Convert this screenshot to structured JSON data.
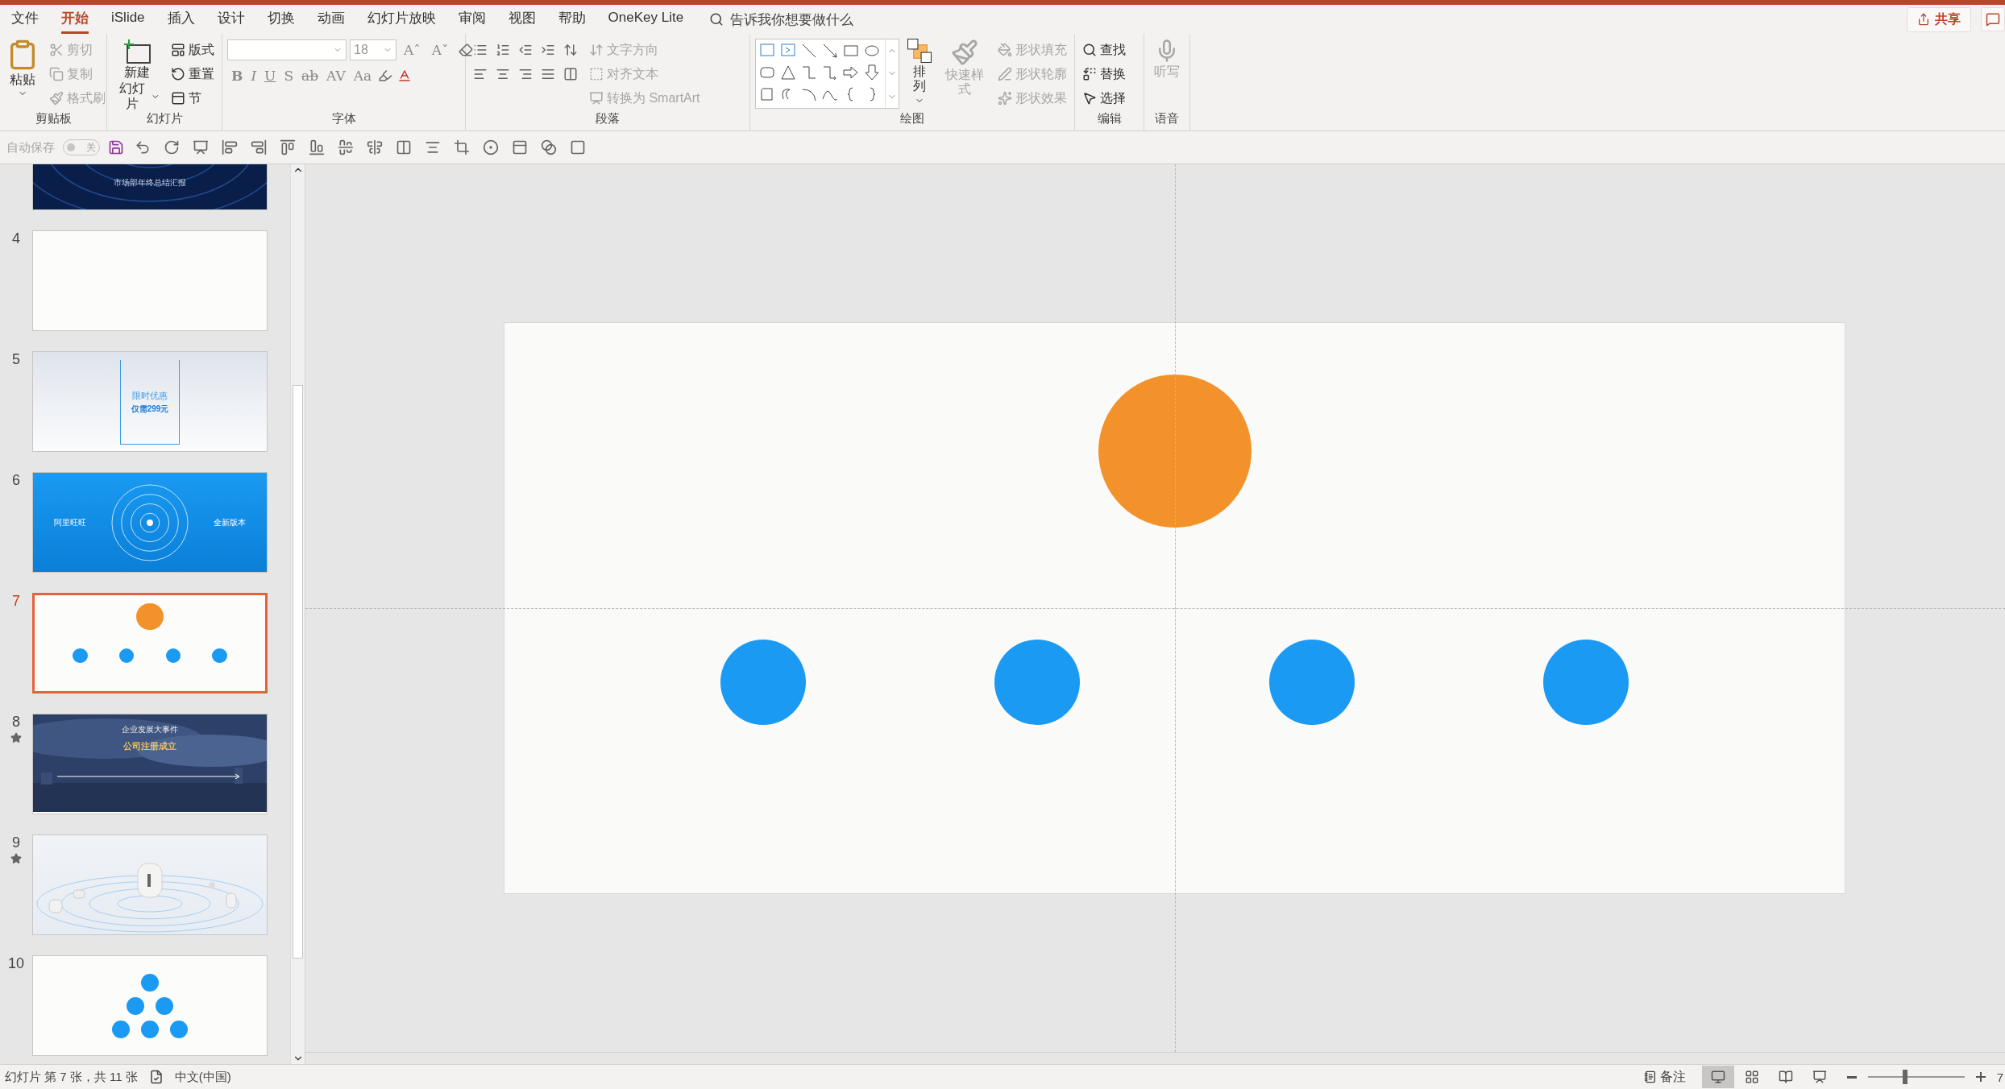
{
  "menu_tabs": [
    {
      "label": "文件",
      "selected": false
    },
    {
      "label": "开始",
      "selected": true
    },
    {
      "label": "iSlide",
      "selected": false
    },
    {
      "label": "插入",
      "selected": false
    },
    {
      "label": "设计",
      "selected": false
    },
    {
      "label": "切换",
      "selected": false
    },
    {
      "label": "动画",
      "selected": false
    },
    {
      "label": "幻灯片放映",
      "selected": false
    },
    {
      "label": "审阅",
      "selected": false
    },
    {
      "label": "视图",
      "selected": false
    },
    {
      "label": "帮助",
      "selected": false
    },
    {
      "label": "OneKey Lite",
      "selected": false
    }
  ],
  "tell_me": {
    "placeholder": "告诉我你想要做什么"
  },
  "share_button": "共享",
  "ribbon": {
    "clipboard": {
      "label": "剪贴板",
      "paste": "粘贴",
      "items": [
        {
          "label": "剪切",
          "disabled": true
        },
        {
          "label": "复制",
          "disabled": true
        },
        {
          "label": "格式刷",
          "disabled": true
        }
      ]
    },
    "slides": {
      "label": "幻灯片",
      "new_slide": [
        "新建",
        "幻灯片"
      ],
      "items": [
        {
          "label": "版式",
          "disabled": false
        },
        {
          "label": "重置",
          "disabled": false
        },
        {
          "label": "节",
          "disabled": false
        }
      ]
    },
    "font": {
      "label": "字体",
      "font_size": "18",
      "size_buttons": [
        "Aˆ",
        "Aˇ"
      ],
      "format_buttons": [
        "B",
        "I",
        "U",
        "S",
        "ab",
        "AV",
        "Aa"
      ]
    },
    "paragraph": {
      "label": "段落",
      "items": [
        {
          "label": "文字方向",
          "disabled": true
        },
        {
          "label": "对齐文本",
          "disabled": true
        },
        {
          "label": "转换为 SmartArt",
          "disabled": true
        }
      ]
    },
    "drawing": {
      "label": "绘图",
      "arrange": "排列",
      "quick_styles": {
        "label": "快速样式",
        "disabled": true
      },
      "items": [
        {
          "label": "形状填充",
          "disabled": true
        },
        {
          "label": "形状轮廓",
          "disabled": true
        },
        {
          "label": "形状效果",
          "disabled": true
        }
      ]
    },
    "editing": {
      "label": "编辑",
      "items": [
        {
          "label": "查找",
          "disabled": false
        },
        {
          "label": "替换",
          "disabled": false
        },
        {
          "label": "选择",
          "disabled": false
        }
      ]
    },
    "voice": {
      "label": "语音",
      "dictate": {
        "label": "听写",
        "disabled": true
      }
    }
  },
  "quick_access": {
    "autosave": {
      "label": "自动保存",
      "toggle": "关",
      "on": false
    }
  },
  "thumbnails": [
    {
      "kind": "dark_title",
      "selected": false,
      "animated": false,
      "texts": [
        "市场部年终总结汇报"
      ]
    },
    {
      "number": "4",
      "kind": "blank",
      "selected": false,
      "animated": false
    },
    {
      "number": "5",
      "kind": "banner",
      "selected": false,
      "animated": false,
      "texts": [
        "限时优惠",
        "仅需299元"
      ]
    },
    {
      "number": "6",
      "kind": "blue_title",
      "selected": false,
      "animated": false,
      "texts": [
        "阿里旺旺",
        "全新版本"
      ]
    },
    {
      "number": "7",
      "kind": "circles_row",
      "selected": true,
      "animated": false
    },
    {
      "number": "8",
      "kind": "photo_timeline",
      "selected": false,
      "animated": true,
      "texts": [
        "企业发展大事件",
        "公司注册成立"
      ]
    },
    {
      "number": "9",
      "kind": "product",
      "selected": false,
      "animated": true
    },
    {
      "number": "10",
      "kind": "circles_pyramid",
      "selected": false,
      "animated": false
    }
  ],
  "slide": {
    "top_circles": [
      {
        "color": "#f3922a"
      }
    ],
    "bottom_circles": [
      {
        "color": "#1a9af2"
      },
      {
        "color": "#1a9af2"
      },
      {
        "color": "#1a9af2"
      },
      {
        "color": "#1a9af2"
      }
    ]
  },
  "status_bar": {
    "slide_info": "幻灯片 第 7 张，共 11 张",
    "language": "中文(中国)",
    "notes_button": "备注",
    "zoom": {
      "level": 0.36
    },
    "zoom_percent": "7"
  }
}
